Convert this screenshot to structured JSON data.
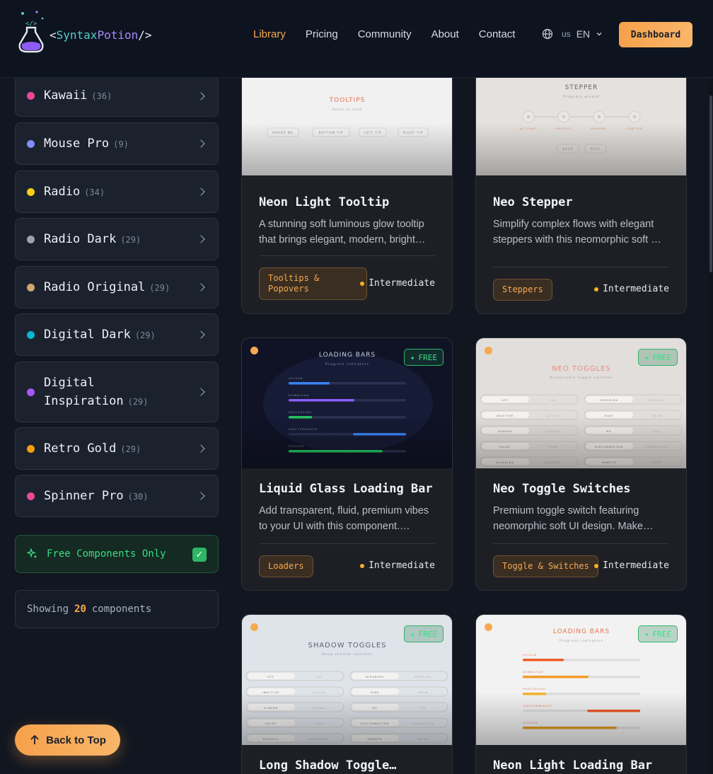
{
  "header": {
    "logo": {
      "open": "<",
      "syntax": "Syntax",
      "potion": "Potion",
      "close": "/>"
    },
    "nav": [
      "Library",
      "Pricing",
      "Community",
      "About",
      "Contact"
    ],
    "active_nav": "Library",
    "lang": {
      "code": "us",
      "label": "EN"
    },
    "dashboard": "Dashboard"
  },
  "sidebar": {
    "items": [
      {
        "name": "Kawaii",
        "count": "(36)",
        "color": "#ec4899"
      },
      {
        "name": "Mouse Pro",
        "count": "(9)",
        "color": "#818cf8"
      },
      {
        "name": "Radio",
        "count": "(34)",
        "color": "#facc15"
      },
      {
        "name": "Radio Dark",
        "count": "(29)",
        "color": "#9ca3af"
      },
      {
        "name": "Radio Original",
        "count": "(29)",
        "color": "#d4a373"
      },
      {
        "name": "Digital Dark",
        "count": "(29)",
        "color": "#06b6d4"
      },
      {
        "name": "Digital Inspiration",
        "count": "(29)",
        "color": "#a855f7"
      },
      {
        "name": "Retro Gold",
        "count": "(29)",
        "color": "#f59e0b"
      },
      {
        "name": "Spinner Pro",
        "count": "(30)",
        "color": "#ec4899"
      }
    ],
    "free_only": "Free Components Only",
    "showing": {
      "prefix": "Showing",
      "count": "20",
      "suffix": "components"
    },
    "back_to_top": "Back to Top"
  },
  "cards": [
    {
      "title": "Neon Light Tooltip",
      "desc": "A stunning soft luminous glow tooltip that brings elegant, modern, bright…",
      "tag": "Tooltips & Popovers",
      "level": "Intermediate",
      "preview": {
        "heading": "TOOLTIPS",
        "sub": "Hover to show",
        "buttons": [
          "HOVER ME",
          "BOTTOM TIP",
          "LEFT TIP",
          "RIGHT TIP"
        ]
      }
    },
    {
      "title": "Neo Stepper",
      "desc": "Simplify complex flows with elegant steppers with this neomorphic soft …",
      "tag": "Steppers",
      "level": "Intermediate",
      "preview": {
        "heading": "STEPPER",
        "sub": "Progress wizard",
        "steps": [
          "ACCOUNT",
          "PROFILE",
          "PAYMENT",
          "CONFIRM"
        ],
        "buttons": [
          "BACK",
          "NEXT"
        ]
      }
    },
    {
      "title": "Liquid Glass Loading Bar",
      "desc": "Add transparent, fluid, premium vibes to your UI with this component.…",
      "tag": "Loaders",
      "level": "Intermediate",
      "free": "FREE",
      "preview": {
        "heading": "LOADING BARS",
        "sub": "Progress indicators",
        "bars": [
          {
            "label": "UPLOAD",
            "value": 0.35,
            "color": "#3b82f6"
          },
          {
            "label": "DOWNLOAD",
            "value": 0.56,
            "color": "#8b5cf6"
          },
          {
            "label": "PROCESSING",
            "value": 0.2,
            "color": "#22c55e"
          },
          {
            "label": "INDETERMINATE",
            "value": 0.45,
            "color": "#3b82f6"
          },
          {
            "label": "STRIPED",
            "value": 0.8,
            "color": "#22c55e"
          }
        ]
      }
    },
    {
      "title": "Neo Toggle Switches",
      "desc": "Premium toggle switch featuring neomorphic soft UI design. Make…",
      "tag": "Toggle & Switches",
      "level": "Intermediate",
      "free": "FREE",
      "preview": {
        "heading": "NEO TOGGLES",
        "sub": "Neomorphic toggle switches",
        "rows": [
          [
            "OFF",
            "ON",
            "OVERRIDE",
            "DEFAULT"
          ],
          [
            "INACTIVE",
            "ACTIVE",
            "HIDE",
            "SHOW"
          ],
          [
            "HIDDEN",
            "VISIBLE",
            "NO",
            "YES"
          ],
          [
            "FALSE",
            "TRUE",
            "DISCONNECTED",
            "CONNECTED"
          ],
          [
            "DISABLED",
            "ENABLED",
            "UNMUTE",
            "MUTE"
          ]
        ]
      }
    },
    {
      "title": "Long Shadow Toggle…",
      "desc": "",
      "tag": "",
      "level": "",
      "free": "FREE",
      "preview": {
        "heading": "SHADOW TOGGLES",
        "sub": "Deep shadow switches",
        "rows": [
          [
            "OFF",
            "ON",
            "DISABLED",
            "ENABLED"
          ],
          [
            "INACTIVE",
            "ACTIVE",
            "HIDE",
            "SHOW"
          ],
          [
            "HIDDEN",
            "VISIBLE",
            "NO",
            "YES"
          ],
          [
            "FALSE",
            "TRUE",
            "DISCONNECTED",
            "CONNECTED"
          ],
          [
            "DEFAULT",
            "OVERRIDE",
            "UNMUTE",
            "MUTE"
          ]
        ]
      }
    },
    {
      "title": "Neon Light Loading Bar",
      "desc": "",
      "tag": "",
      "level": "",
      "free": "FREE",
      "preview": {
        "heading": "LOADING BARS",
        "sub": "Progress indicators",
        "bars": [
          {
            "label": "UPLOAD",
            "value": 0.35,
            "color": "#f05a28"
          },
          {
            "label": "DOWNLOAD",
            "value": 0.56,
            "color": "#f39c2a"
          },
          {
            "label": "PROCESSING",
            "value": 0.2,
            "color": "#f3b52a"
          },
          {
            "label": "INDETERMINATE",
            "value": 0.45,
            "color": "#f05a28"
          },
          {
            "label": "STRIPED",
            "value": 0.8,
            "color": "#e09a23"
          }
        ]
      }
    }
  ],
  "colors": {
    "accent": "#f6a94f",
    "free": "#3ddc84",
    "background": "#111620"
  }
}
